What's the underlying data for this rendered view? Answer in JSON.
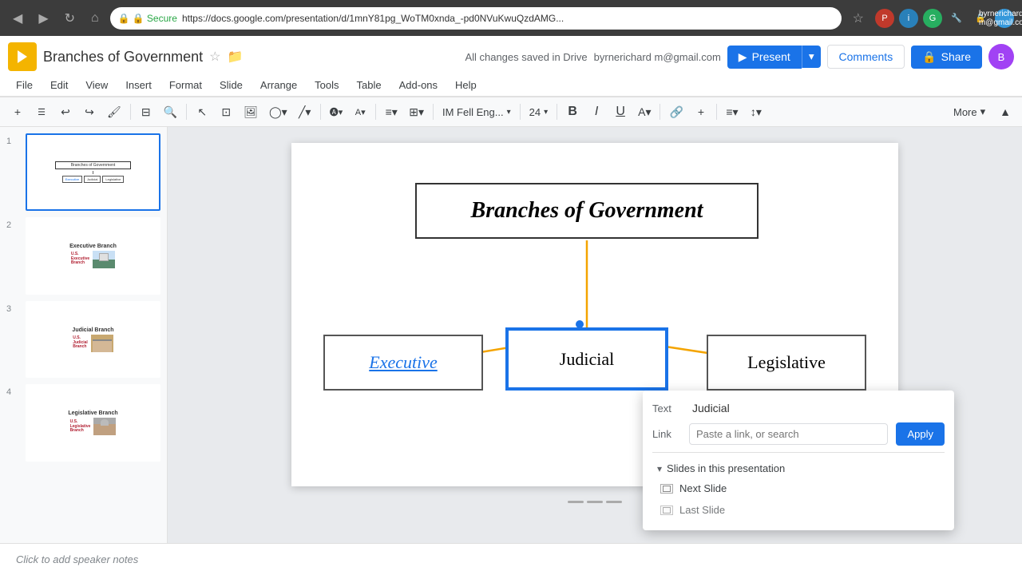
{
  "browser": {
    "back_label": "◀",
    "forward_label": "▶",
    "refresh_label": "↻",
    "home_label": "⌂",
    "secure_label": "🔒 Secure",
    "url": "https://docs.google.com/presentation/d/1mnY81pg_WoTM0xnda_-pd0NVuKwuQzdAMG...",
    "bookmark_label": "☆",
    "user_email": "byrnerichard m@gmail.com"
  },
  "app": {
    "logo_letter": "▶",
    "title": "Branches of Government",
    "star_label": "☆",
    "folder_label": "📁",
    "autosave_text": "All changes saved in Drive",
    "present_label": "Present",
    "comments_label": "Comments",
    "share_label": "Share",
    "user_initials": "B"
  },
  "menu": {
    "items": [
      {
        "label": "File",
        "id": "file"
      },
      {
        "label": "Edit",
        "id": "edit"
      },
      {
        "label": "View",
        "id": "view"
      },
      {
        "label": "Insert",
        "id": "insert"
      },
      {
        "label": "Format",
        "id": "format"
      },
      {
        "label": "Slide",
        "id": "slide"
      },
      {
        "label": "Arrange",
        "id": "arrange"
      },
      {
        "label": "Tools",
        "id": "tools"
      },
      {
        "label": "Table",
        "id": "table"
      },
      {
        "label": "Add-ons",
        "id": "addons"
      },
      {
        "label": "Help",
        "id": "help"
      }
    ]
  },
  "toolbar": {
    "more_label": "More",
    "font_label": "IM Fell Eng...",
    "font_size": "24",
    "bold": "B",
    "italic": "I",
    "underline": "U",
    "collapse_label": "▲"
  },
  "slides": [
    {
      "number": "1",
      "active": true,
      "type": "diagram",
      "title": "Branches of Government"
    },
    {
      "number": "2",
      "active": false,
      "type": "photo",
      "title": "Executive Branch"
    },
    {
      "number": "3",
      "active": false,
      "type": "photo",
      "title": "Judicial Branch"
    },
    {
      "number": "4",
      "active": false,
      "type": "photo",
      "title": "Legislative Branch"
    }
  ],
  "canvas": {
    "main_title": "Branches of Government",
    "executive_label": "Executive",
    "judicial_label": "Judicial",
    "legislative_label": "Legislative"
  },
  "link_popup": {
    "text_label": "Text",
    "link_label": "Link",
    "text_value": "Judicial",
    "link_placeholder": "Paste a link, or search",
    "apply_label": "Apply",
    "slides_section": "Slides in this presentation",
    "item1_label": "Next Slide",
    "item2_label": "Last Slide"
  },
  "speaker_notes": {
    "placeholder": "Click to add speaker notes"
  }
}
